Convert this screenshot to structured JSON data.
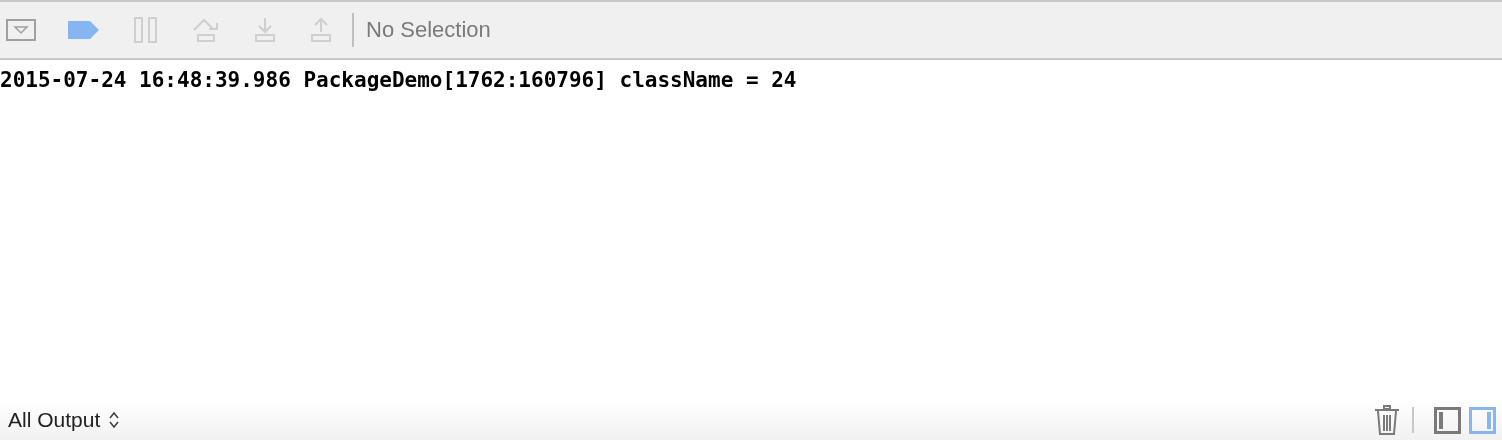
{
  "toolbar": {
    "breakpoints_active": true,
    "selection_label": "No Selection"
  },
  "console": {
    "lines": [
      "2015-07-24 16:48:39.986 PackageDemo[1762:160796] className = 24"
    ]
  },
  "footer": {
    "output_filter": "All Output",
    "panel_toggles": [
      {
        "kind": "left",
        "selected": false
      },
      {
        "kind": "right",
        "selected": true
      }
    ]
  }
}
